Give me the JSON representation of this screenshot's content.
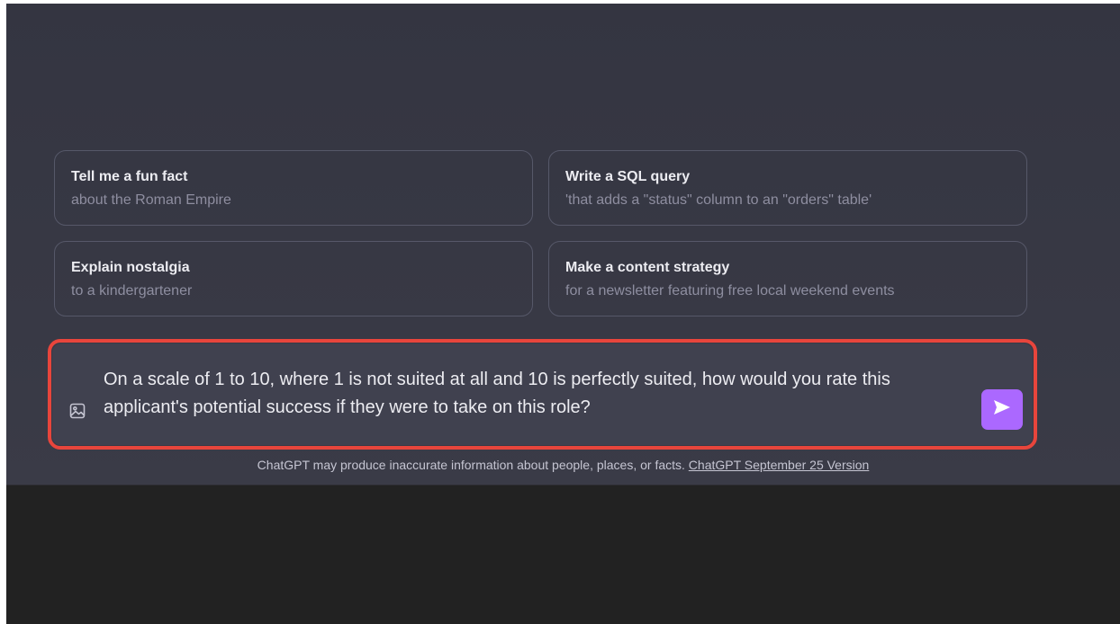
{
  "suggestions": [
    {
      "title": "Tell me a fun fact",
      "subtitle": "about the Roman Empire"
    },
    {
      "title": "Write a SQL query",
      "subtitle": "'that adds a \"status\" column to an \"orders\" table'"
    },
    {
      "title": "Explain nostalgia",
      "subtitle": "to a kindergartener"
    },
    {
      "title": "Make a content strategy",
      "subtitle": "for a newsletter featuring free local weekend events"
    }
  ],
  "composer": {
    "value": "On a scale of 1 to 10, where 1 is not suited at all and 10 is perfectly suited, how would you rate this applicant's potential success if they were to take on this role?",
    "attach_icon": "image-icon",
    "send_icon": "send-arrow-icon"
  },
  "footer": {
    "disclaimer": "ChatGPT may produce inaccurate information about people, places, or facts.",
    "version_link": "ChatGPT September 25 Version"
  },
  "colors": {
    "panel_background": "#343541",
    "lower_background": "#222222",
    "card_border": "#565869",
    "input_background": "#40414f",
    "highlight_outline": "#e8453c",
    "send_button": "#ab68ff"
  }
}
